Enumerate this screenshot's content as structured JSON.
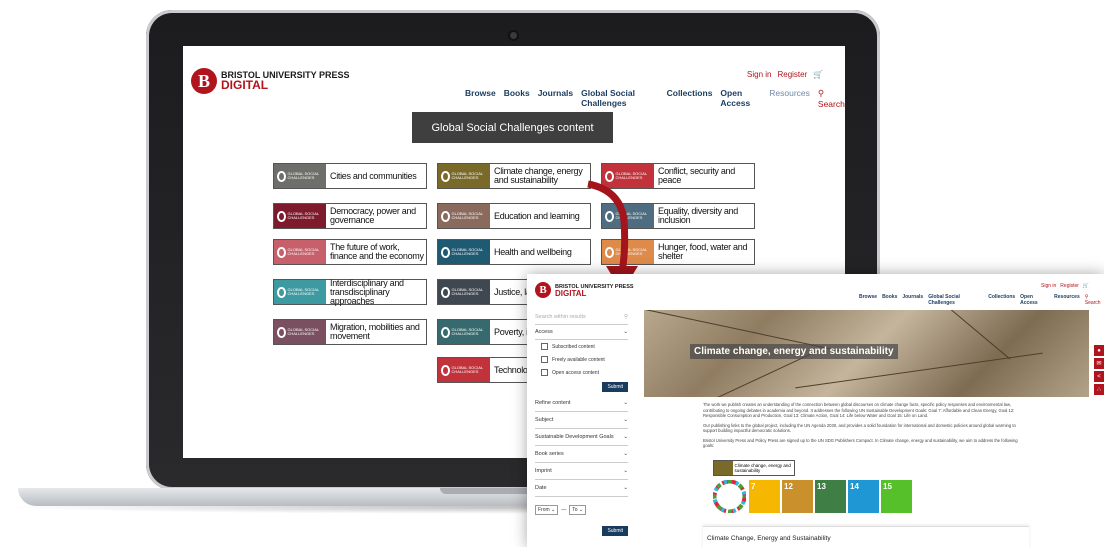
{
  "laptop": {
    "logo": {
      "letter": "B",
      "line1": "BRISTOL UNIVERSITY PRESS",
      "line2": "DIGITAL"
    },
    "top_links": {
      "signin": "Sign in",
      "register": "Register",
      "cart_icon": "cart-icon"
    },
    "nav": [
      "Browse",
      "Books",
      "Journals",
      "Global Social Challenges",
      "Collections",
      "Open Access",
      "Resources",
      "Search"
    ],
    "section_title": "Global Social Challenges content",
    "badge_text": "GLOBAL SOCIAL CHALLENGES",
    "tiles": [
      {
        "label": "Cities and communities",
        "color": "#6e6f6a"
      },
      {
        "label": "Climate change, energy and sustainability",
        "color": "#7a6a2a"
      },
      {
        "label": "Conflict, security and peace",
        "color": "#c2323a"
      },
      {
        "label": "Democracy, power and governance",
        "color": "#7d1a2b"
      },
      {
        "label": "Education and learning",
        "color": "#8a6a5c"
      },
      {
        "label": "Equality, diversity and inclusion",
        "color": "#4e6d80"
      },
      {
        "label": "The future of work, finance and the economy",
        "color": "#c8606b"
      },
      {
        "label": "Health and wellbeing",
        "color": "#1f5a73"
      },
      {
        "label": "Hunger, food, water and shelter",
        "color": "#de8a4a"
      },
      {
        "label": "Interdisciplinary and transdisciplinary approaches",
        "color": "#3d9aa0"
      },
      {
        "label": "Justice, law",
        "color": "#3f4750"
      },
      {
        "label": "Migration, mobilities and movement",
        "color": "#7a5060"
      },
      {
        "label": "Poverty, ine and social j",
        "color": "#366a6e"
      },
      {
        "label": "Technology, and society",
        "color": "#c2323a"
      }
    ]
  },
  "tablet": {
    "logo": {
      "letter": "B",
      "line1": "BRISTOL UNIVERSITY PRESS",
      "line2": "DIGITAL"
    },
    "top_links": {
      "signin": "Sign in",
      "register": "Register"
    },
    "nav": [
      "Browse",
      "Books",
      "Journals",
      "Global Social Challenges",
      "Collections",
      "Open Access",
      "Resources",
      "Search"
    ],
    "sidebar": {
      "search_placeholder": "Search within results",
      "access": "Access",
      "checks": [
        "Subscribed content",
        "Freely available content",
        "Open access content"
      ],
      "submit": "Submit",
      "filters": [
        "Refine content",
        "Subject",
        "Sustainable Development Goals",
        "Book series",
        "Imprint",
        "Date"
      ],
      "from": "From",
      "to": "To",
      "date_separator": "—",
      "submit2": "Submit"
    },
    "hero_title": "Climate change, energy and sustainability",
    "paragraphs": [
      "The work we publish creates an understanding of the connection between global discourses on climate change facts, specific policy responses and environmental law, contributing to ongoing debates in academia and beyond. It addresses the following UN Sustainable Development Goals: Goal 7: Affordable and Clean Energy, Goal 12: Responsible Consumption and Production, Goal 13: Climate Action, Goal 14: Life below Water and Goal 15: Life on Land.",
      "Our publishing links to the global project, including the UN Agenda 2030, and provides a solid foundation for international and domestic policies around global warming to support building impactful democratic solutions.",
      "Bristol University Press and Policy Press are signed up to the UN SDG Publishers Compact. In Climate change, energy and sustainability, we aim to address the following goals:"
    ],
    "tile_label": "Climate change, energy and sustainability",
    "sdgs": [
      {
        "num": "7",
        "color": "#f5b700"
      },
      {
        "num": "12",
        "color": "#c9902b"
      },
      {
        "num": "13",
        "color": "#3f7e44"
      },
      {
        "num": "14",
        "color": "#1f97d4"
      },
      {
        "num": "15",
        "color": "#56c02b"
      }
    ],
    "result_title": "Climate Change, Energy and Sustainability",
    "right_buttons": [
      "lock-icon",
      "mail-icon",
      "share-icon",
      "rss-icon"
    ]
  }
}
